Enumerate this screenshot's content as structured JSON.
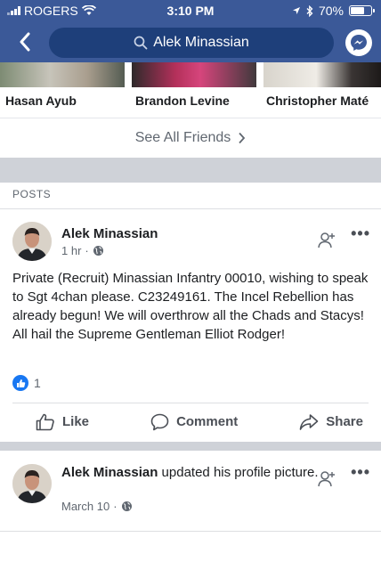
{
  "status_bar": {
    "carrier": "ROGERS",
    "time": "3:10 PM",
    "battery": "70%",
    "battery_level": 0.7
  },
  "nav": {
    "search_text": "Alek Minassian"
  },
  "friends": {
    "names": [
      "Hasan Ayub",
      "Brandon Levine",
      "Christopher Maté"
    ],
    "see_all": "See All Friends"
  },
  "posts_section": {
    "label": "POSTS"
  },
  "post1": {
    "author": "Alek Minassian",
    "time": "1 hr",
    "text": "Private (Recruit) Minassian Infantry 00010, wishing to speak to Sgt 4chan please. C23249161. The Incel Rebellion has already begun! We will overthrow all the Chads and Stacys! All hail the Supreme Gentleman Elliot Rodger!",
    "like_count": "1",
    "actions": {
      "like": "Like",
      "comment": "Comment",
      "share": "Share"
    }
  },
  "post2": {
    "author": "Alek Minassian",
    "action_text": " updated his profile picture.",
    "time": "March 10"
  },
  "colors": {
    "brand": "#3b5998",
    "like_blue": "#1877f2"
  }
}
